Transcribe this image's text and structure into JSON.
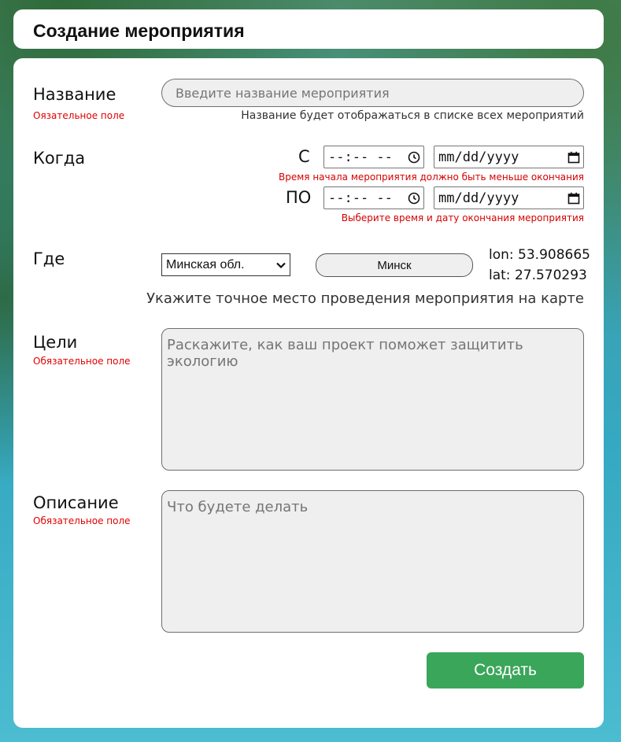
{
  "header": {
    "title": "Создание мероприятия"
  },
  "name_section": {
    "label": "Название",
    "required": "Оязательное поле",
    "placeholder": "Введите название мероприятия",
    "hint": "Название будет отображаться в списке всех мероприятий"
  },
  "when_section": {
    "label": "Когда",
    "from_label": "С",
    "to_label": "ПО",
    "time_value": "--:-- --",
    "date_value": "mm/dd/yyyy",
    "from_error": "Время начала мероприятия должно быть меньше окончания",
    "to_error": "Выберите время и дату окончания мероприятия"
  },
  "where_section": {
    "label": "Где",
    "region_selected": "Минская обл.",
    "city_button": "Минск",
    "lon": "lon: 53.908665",
    "lat": "lat: 27.570293",
    "map_hint": "Укажите точное место проведения мероприятия на карте"
  },
  "goals_section": {
    "label": "Цели",
    "required": "Обязательное поле",
    "placeholder": "Раскажите, как ваш проект поможет защитить экологию"
  },
  "desc_section": {
    "label": "Описание",
    "required": "Обязательное поле",
    "placeholder": "Что будете делать"
  },
  "actions": {
    "submit_label": "Создать"
  },
  "icons": {
    "clock": "clock-icon",
    "calendar": "calendar-icon",
    "dropdown": "chevron-down-icon"
  },
  "colors": {
    "accent": "#3aa65a",
    "error": "#e00000"
  }
}
